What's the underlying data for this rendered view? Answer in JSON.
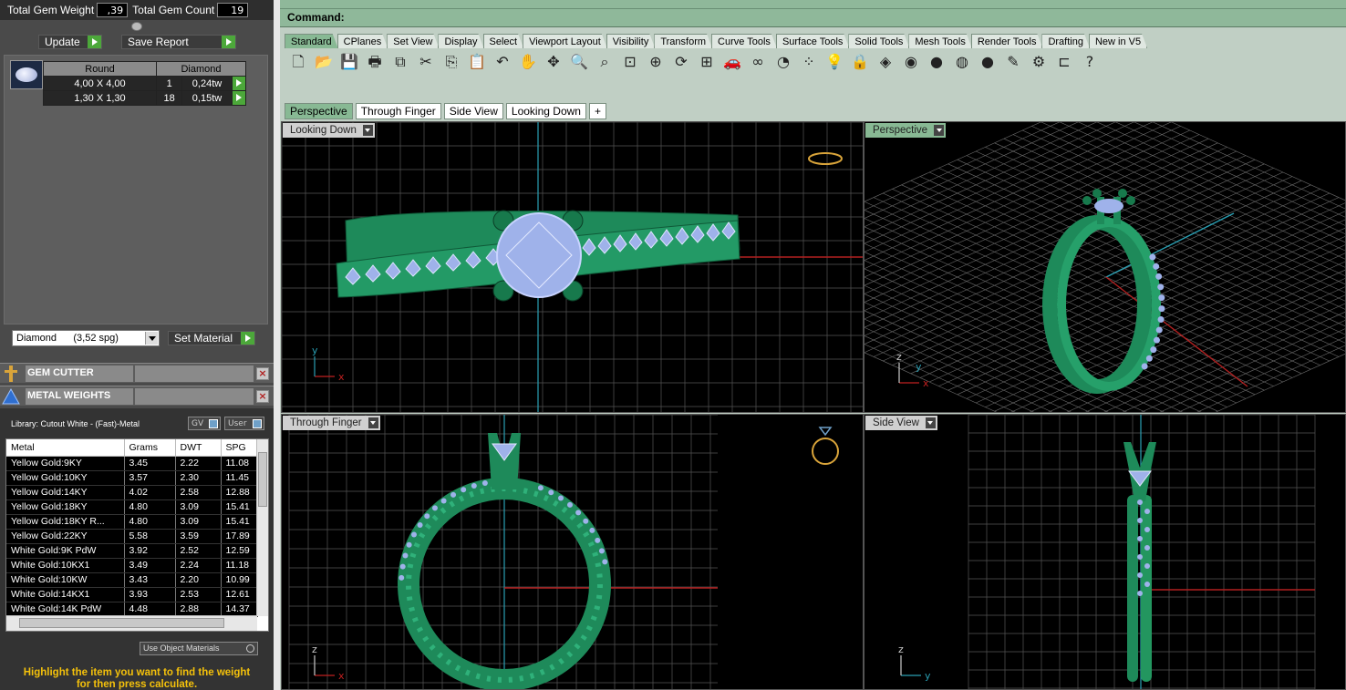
{
  "left_panel": {
    "total_gem_weight_label": "Total Gem Weight",
    "total_gem_weight_value": ",39",
    "total_gem_count_label": "Total Gem Count",
    "total_gem_count_value": "19",
    "update_label": "Update",
    "save_report_label": "Save Report",
    "gem_table": {
      "headers": [
        "Round",
        "Diamond"
      ],
      "rows": [
        {
          "size": "4,00 X 4,00",
          "count": "1",
          "weight": "0,24tw"
        },
        {
          "size": "1,30 X 1,30",
          "count": "18",
          "weight": "0,15tw"
        }
      ]
    },
    "material_select": "Diamond      (3,52 spg)",
    "set_material_label": "Set Material",
    "sections": {
      "gem_cutter": "GEM CUTTER",
      "metal_weights": "METAL WEIGHTS"
    },
    "library_label": "Library: Cutout White - (Fast)-Metal",
    "gv_label": "GV",
    "user_label": "User",
    "metal_table": {
      "headers": [
        "Metal",
        "Grams",
        "DWT",
        "SPG"
      ],
      "rows": [
        [
          "Yellow Gold:9KY",
          "3.45",
          "2.22",
          "11.08"
        ],
        [
          "Yellow Gold:10KY",
          "3.57",
          "2.30",
          "11.45"
        ],
        [
          "Yellow Gold:14KY",
          "4.02",
          "2.58",
          "12.88"
        ],
        [
          "Yellow Gold:18KY",
          "4.80",
          "3.09",
          "15.41"
        ],
        [
          "Yellow Gold:18KY R...",
          "4.80",
          "3.09",
          "15.41"
        ],
        [
          "Yellow Gold:22KY",
          "5.58",
          "3.59",
          "17.89"
        ],
        [
          "White Gold:9K PdW",
          "3.92",
          "2.52",
          "12.59"
        ],
        [
          "White Gold:10KX1",
          "3.49",
          "2.24",
          "11.18"
        ],
        [
          "White Gold:10KW",
          "3.43",
          "2.20",
          "10.99"
        ],
        [
          "White Gold:14KX1",
          "3.93",
          "2.53",
          "12.61"
        ],
        [
          "White Gold:14K PdW",
          "4.48",
          "2.88",
          "14.37"
        ]
      ]
    },
    "use_object_materials": "Use Object Materials",
    "hint_line1": "Highlight the item you want to find the weight",
    "hint_line2": "for then press calculate."
  },
  "command": {
    "label": "Command:"
  },
  "toolbar_tabs": [
    "Standard",
    "CPlanes",
    "Set View",
    "Display",
    "Select",
    "Viewport Layout",
    "Visibility",
    "Transform",
    "Curve Tools",
    "Surface Tools",
    "Solid Tools",
    "Mesh Tools",
    "Render Tools",
    "Drafting",
    "New in V5"
  ],
  "tools": [
    "new-icon",
    "open-icon",
    "save-icon",
    "print-icon",
    "import-icon",
    "cut-icon",
    "copy-icon",
    "paste-icon",
    "undo-icon",
    "pan-hand-icon",
    "move-view-icon",
    "zoom-icon",
    "zoom-window-icon",
    "zoom-extents-icon",
    "zoom-selected-icon",
    "rotate-view-icon",
    "four-viewports-icon",
    "car-icon",
    "hide-icon",
    "lock-circle-icon",
    "points-icon",
    "light-icon",
    "lock-icon",
    "material-icon",
    "color-wheel-icon",
    "shaded-sphere-icon",
    "rendered-sphere-icon",
    "blue-sphere-icon",
    "pencil-icon",
    "settings-icon",
    "snap-icon",
    "help-icon"
  ],
  "tool_glyphs": [
    "🗋",
    "📂",
    "💾",
    "🖶",
    "⧉",
    "✂",
    "⎘",
    "📋",
    "↶",
    "✋",
    "✥",
    "🔍",
    "⌕",
    "⊡",
    "⊕",
    "⟳",
    "⊞",
    "🚗",
    "∞",
    "◔",
    "⁘",
    "💡",
    "🔒",
    "◈",
    "◉",
    "●",
    "◍",
    "●",
    "✎",
    "⚙",
    "⊏",
    "?"
  ],
  "viewport_tabs": [
    "Perspective",
    "Through Finger",
    "Side View",
    "Looking Down",
    "+"
  ],
  "viewports": {
    "top_left": "Looking Down",
    "top_right": "Perspective",
    "bottom_left": "Through Finger",
    "bottom_right": "Side View"
  },
  "axis_labels": {
    "x": "x",
    "y": "y",
    "z": "z"
  },
  "colors": {
    "ring": "#1e8a5a",
    "gem": "#9fb2ea",
    "active_tab": "#88b994",
    "accent_green": "#4ca83a",
    "hint_yellow": "#f4c10b"
  }
}
